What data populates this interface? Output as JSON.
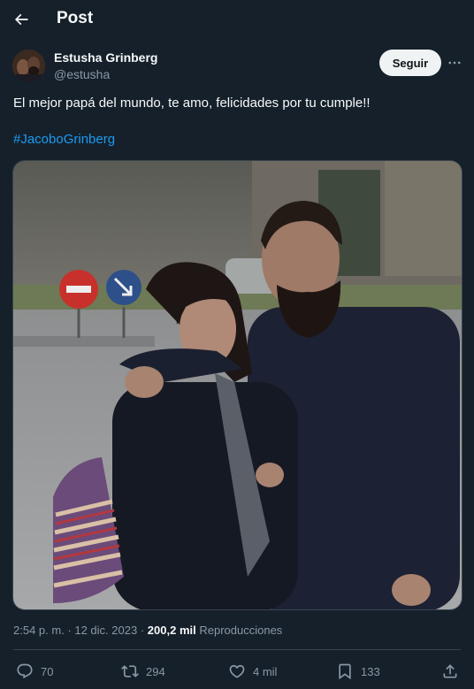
{
  "header": {
    "title": "Post",
    "back_icon": "arrow-left-icon"
  },
  "author": {
    "name": "Estusha Grinberg",
    "handle": "@estusha"
  },
  "follow_label": "Seguir",
  "more_icon": "more-horizontal-icon",
  "post": {
    "text": "El mejor papá del mundo, te amo, felicidades por tu cumple!!",
    "hashtag": "#JacoboGrinberg",
    "media_icon": "photo"
  },
  "meta": {
    "timestamp": "2:54 p. m. · 12 dic. 2023",
    "separator": "·",
    "views_count": "200,2 mil",
    "views_label": "Reproducciones"
  },
  "actions": {
    "replies": "70",
    "reposts": "294",
    "likes": "4 mil",
    "bookmarks": "133"
  },
  "colors": {
    "background": "#15202b",
    "link": "#1d9bf0",
    "secondary_text": "#8b98a5",
    "border": "#38444d"
  }
}
